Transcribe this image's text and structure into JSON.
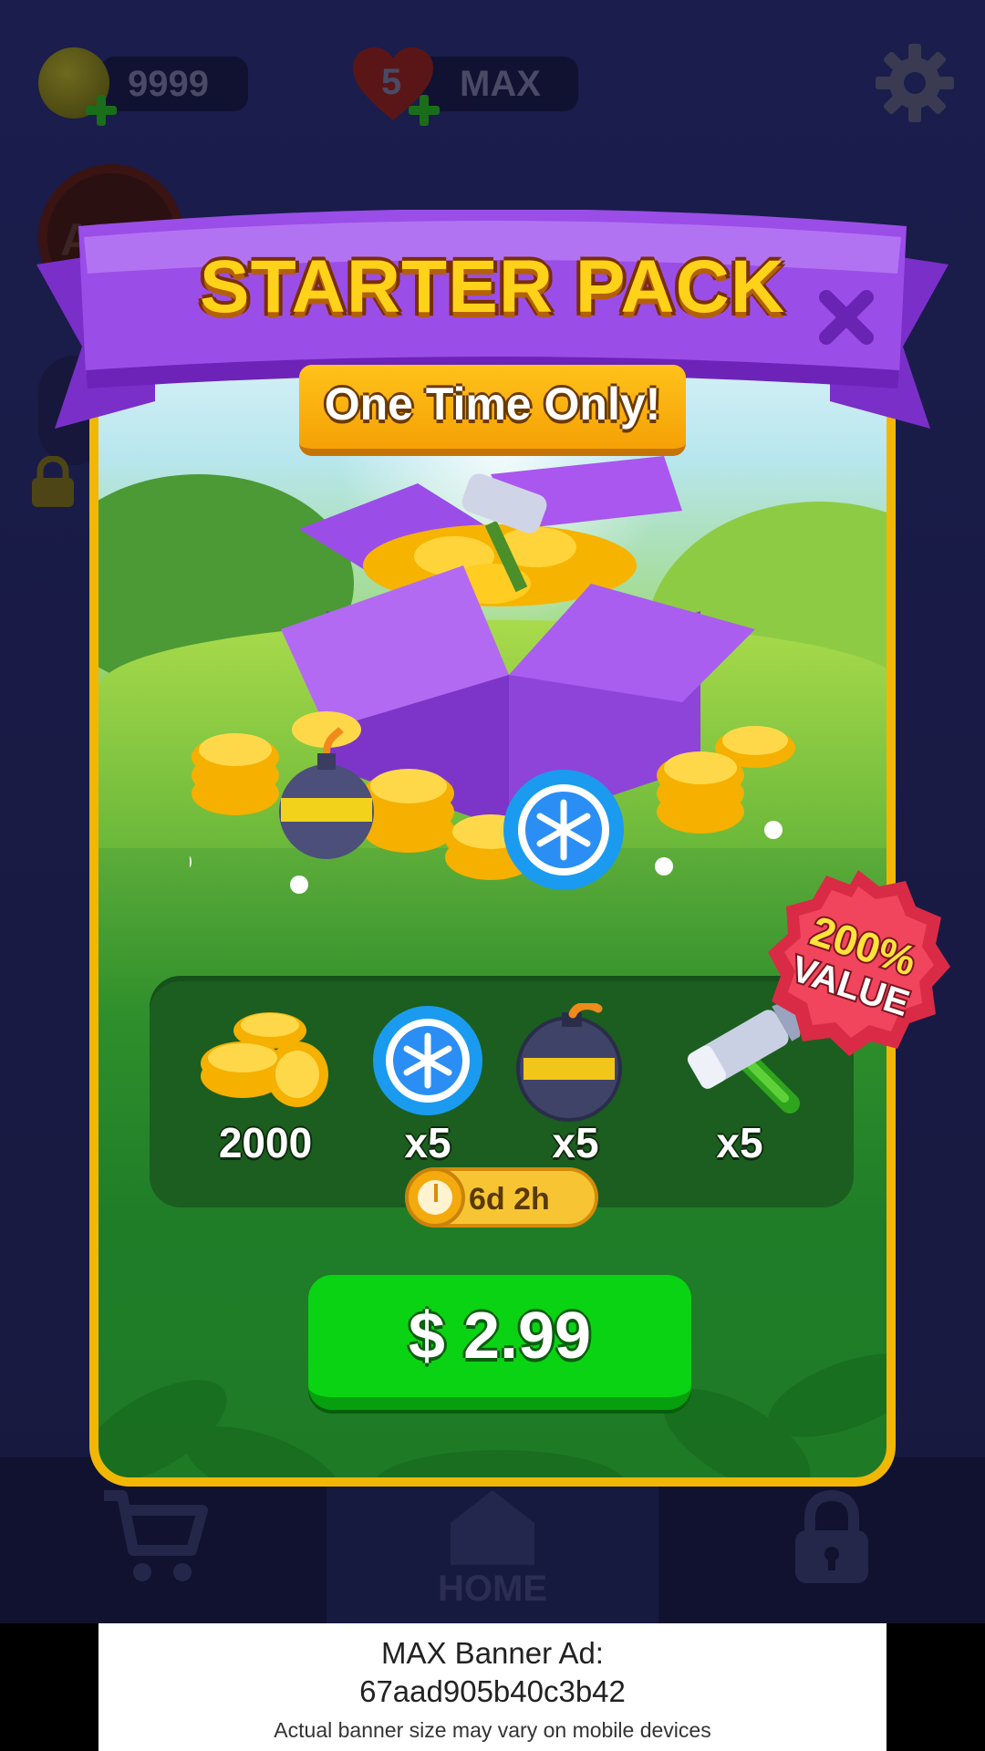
{
  "background": {
    "coins": "9999",
    "lives_count": "5",
    "lives_status": "MAX",
    "ads_label": "ADS",
    "nav": {
      "home_label": "HOME"
    }
  },
  "popup": {
    "title": "STARTER PACK",
    "subtitle": "One Time Only!",
    "close_icon": "close-icon",
    "badge": {
      "line1": "200%",
      "line2": "VALUE"
    },
    "rewards": [
      {
        "icon": "coins-icon",
        "qty": "2000"
      },
      {
        "icon": "snowflake-booster-icon",
        "qty": "x5"
      },
      {
        "icon": "bomb-booster-icon",
        "qty": "x5"
      },
      {
        "icon": "hammer-booster-icon",
        "qty": "x5"
      }
    ],
    "timer": "6d 2h",
    "price": "$ 2.99"
  },
  "ad_banner": {
    "line1": "MAX Banner Ad:",
    "line2": "67aad905b40c3b42",
    "line3": "Actual banner size may vary on mobile devices"
  },
  "colors": {
    "ribbon_purple": "#9b4de8",
    "frame_gold": "#f2b705",
    "buy_green": "#0ad313",
    "badge_red": "#e8384f"
  }
}
